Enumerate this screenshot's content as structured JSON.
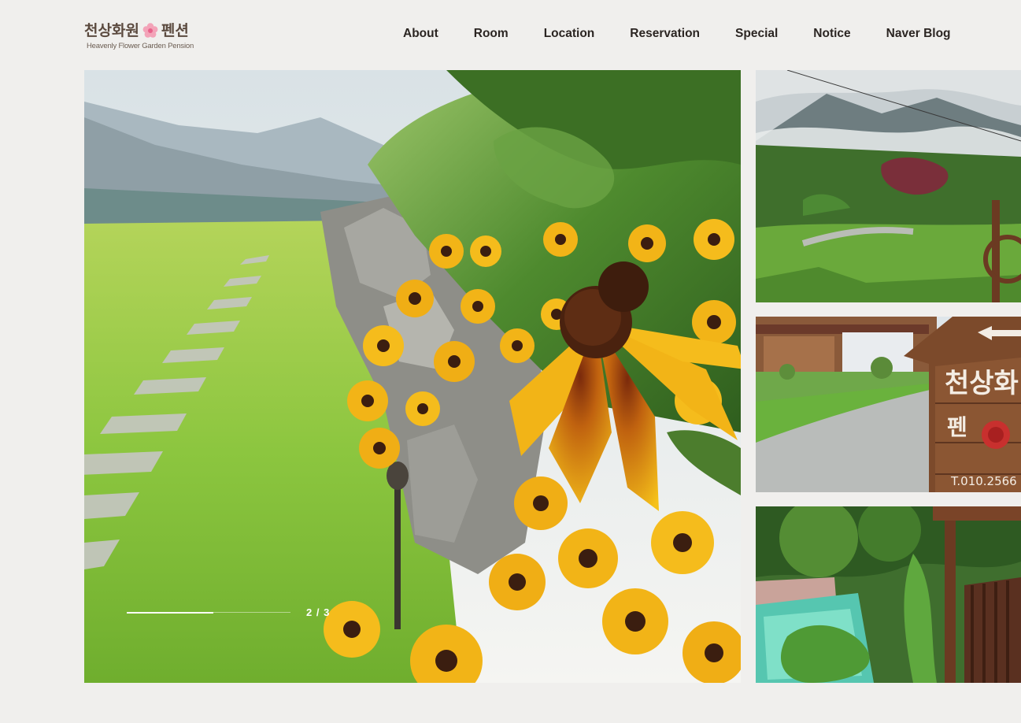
{
  "brand": {
    "name_ko": "천상화원",
    "suffix_ko": "펜션",
    "name_en": "Heavenly Flower Garden Pension"
  },
  "nav": {
    "items": [
      "About",
      "Room",
      "Location",
      "Reservation",
      "Special",
      "Notice",
      "Naver Blog"
    ]
  },
  "slider": {
    "counter": "2 / 3",
    "current": 2,
    "total": 3,
    "progress_fraction": 0.53
  },
  "thumbs": {
    "sign": {
      "line1": "천상화",
      "line2": "펜",
      "phone": "T.010.2566"
    }
  },
  "colors": {
    "background": "#f0efed",
    "nav_text": "#2b2522",
    "logo_text": "#5b4a3f",
    "flower_yellow": "#f2b417",
    "grass_green": "#8cc63f"
  }
}
